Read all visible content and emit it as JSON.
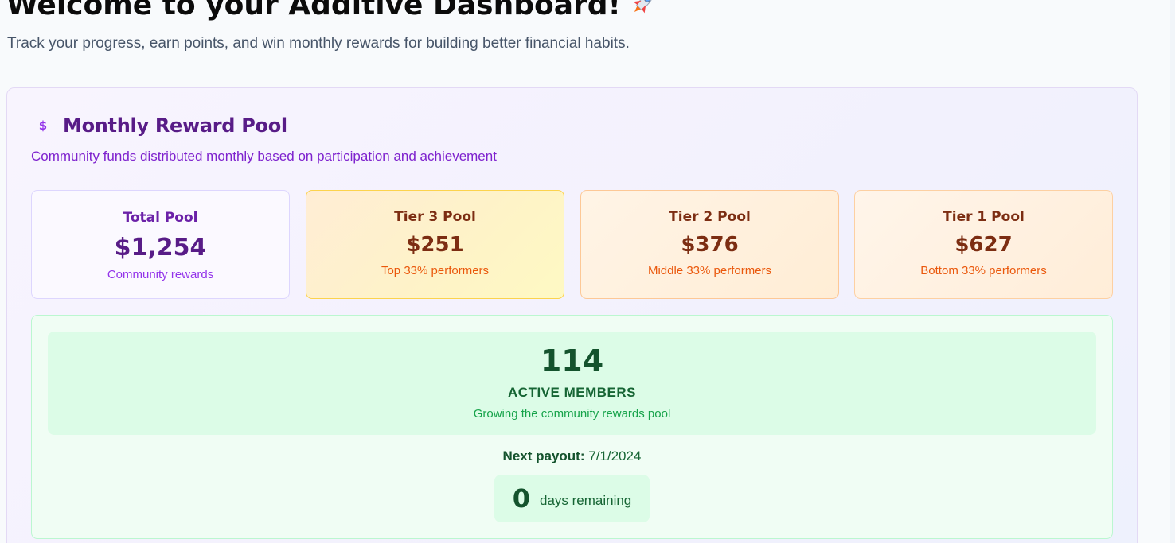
{
  "header": {
    "title": "Welcome to your Additive Dashboard!",
    "subtitle": "Track your progress, earn points, and win monthly rewards for building better financial habits."
  },
  "reward_pool": {
    "title": "Monthly Reward Pool",
    "description": "Community funds distributed monthly based on participation and achievement",
    "icon": "dollar-icon",
    "tiers": [
      {
        "label": "Total Pool",
        "value": "$1,254",
        "sub": "Community rewards"
      },
      {
        "label": "Tier 3 Pool",
        "value": "$251",
        "sub": "Top 33% performers"
      },
      {
        "label": "Tier 2 Pool",
        "value": "$376",
        "sub": "Middle 33% performers"
      },
      {
        "label": "Tier 1 Pool",
        "value": "$627",
        "sub": "Bottom 33% performers"
      }
    ],
    "members": {
      "count": "114",
      "label": "ACTIVE MEMBERS",
      "sub": "Growing the community rewards pool"
    },
    "payout": {
      "label": "Next payout:",
      "date": "7/1/2024",
      "days": "0",
      "days_label": "days remaining"
    }
  },
  "colors": {
    "purple_title": "#581c87",
    "purple_accent": "#7e22ce",
    "orange_sub": "#ea580c",
    "green_dark": "#14532d"
  }
}
